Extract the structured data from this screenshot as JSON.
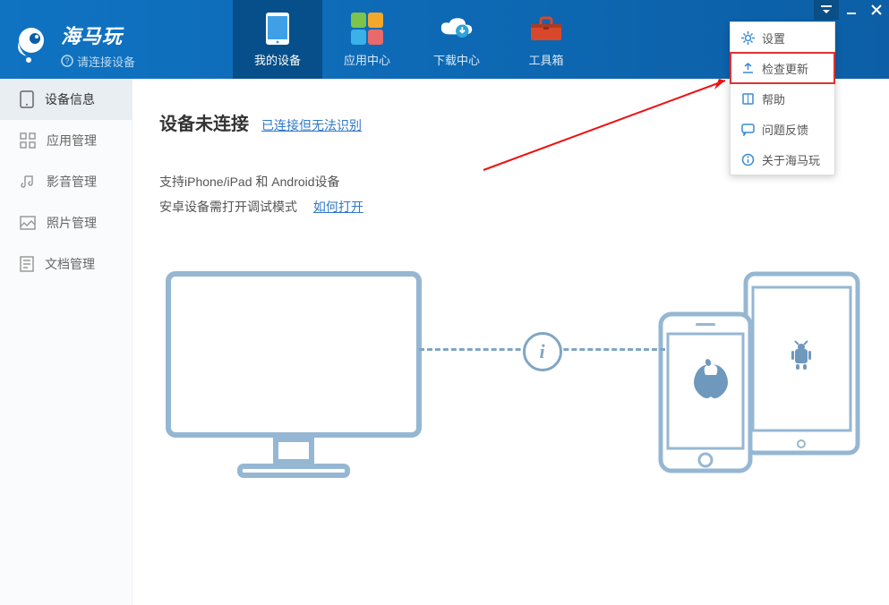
{
  "brand": {
    "title": "海马玩",
    "subtitle": "请连接设备"
  },
  "nav": {
    "device": "我的设备",
    "apps": "应用中心",
    "download": "下载中心",
    "toolbox": "工具箱"
  },
  "menu": {
    "settings": "设置",
    "update": "检查更新",
    "help": "帮助",
    "feedback": "问题反馈",
    "about": "关于海马玩"
  },
  "sidebar": {
    "device_info": "设备信息",
    "app_mgmt": "应用管理",
    "media_mgmt": "影音管理",
    "photo_mgmt": "照片管理",
    "doc_mgmt": "文档管理"
  },
  "content": {
    "title": "设备未连接",
    "title_link": "已连接但无法识别",
    "hint1": "支持iPhone/iPad 和 Android设备",
    "hint2": "安卓设备需打开调试模式",
    "hint2_link": "如何打开"
  }
}
